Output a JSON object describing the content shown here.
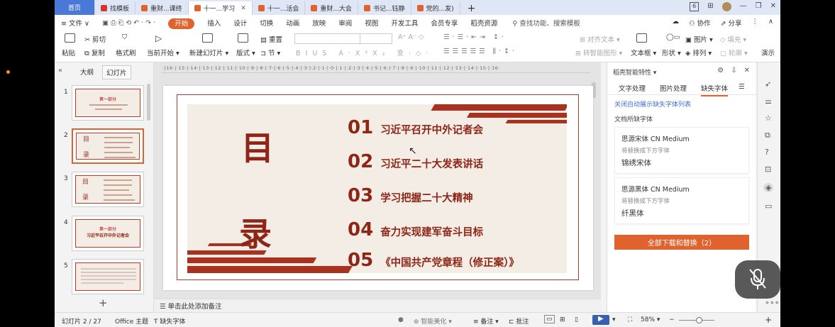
{
  "tabs": [
    {
      "label": "首页",
      "kind": "home"
    },
    {
      "label": "找模板",
      "kind": "red"
    },
    {
      "label": "重财...课终",
      "kind": "doc"
    },
    {
      "label": "十一...学习",
      "kind": "doc",
      "active": true
    },
    {
      "label": "十一...活会",
      "kind": "doc"
    },
    {
      "label": "重财...大会",
      "kind": "doc"
    },
    {
      "label": "书记...钰静",
      "kind": "doc"
    },
    {
      "label": "党的...发)",
      "kind": "doc"
    }
  ],
  "window": {
    "badge": "6",
    "add_tab": "+"
  },
  "menu": {
    "file": "≡ 文件 ∨",
    "start": "开始",
    "items": [
      "插入",
      "设计",
      "切换",
      "动画",
      "放映",
      "审阅",
      "视图",
      "开发工具",
      "会员专享",
      "稻壳资源"
    ],
    "search": "查找功能、搜索模板",
    "collab": "协作",
    "share": "分享"
  },
  "toolbar": {
    "paste": "粘贴",
    "cut": "剪切",
    "copy": "复制",
    "format_painter": "格式刷",
    "from_current": "当前开始",
    "new_slide": "新建幻灯片",
    "layout": "版式",
    "section": "节",
    "reset": "重置",
    "textbox": "文本框",
    "shape": "形状",
    "arrange": "排列",
    "picture": "图片",
    "fill": "填充",
    "outline": "轮廓",
    "align_text": "对齐文本",
    "smartart": "转智能图形",
    "present": "演示"
  },
  "leftpanel": {
    "outline_tab": "大纲",
    "slides_tab": "幻灯片",
    "thumbs": [
      {
        "num": "1",
        "type": "title",
        "text": "第一部分"
      },
      {
        "num": "2",
        "type": "toc",
        "selected": true
      },
      {
        "num": "3",
        "type": "toc"
      },
      {
        "num": "4",
        "type": "section",
        "text": "习近平召开中外记者会"
      },
      {
        "num": "5",
        "type": "text"
      }
    ]
  },
  "ruler": "·|16·|·15·|·14·|·13·|·12·|·11·|·10·|·9·|·8·|·7·|·6·|·5·|·4·|·3·|·2·|·1·|·0·|·1·|·2·|·3·|·4·|·5·|·6·|·7·|·8·|·9·|·10·|·11·|·12·|·13·|·14·|·15·|·16·",
  "slide": {
    "char1": "目",
    "char2": "录",
    "items": [
      {
        "num": "01",
        "text": "习近平召开中外记者会"
      },
      {
        "num": "02",
        "text": "习近平二十大发表讲话"
      },
      {
        "num": "03",
        "text": "学习把握二十大精神"
      },
      {
        "num": "04",
        "text": "奋力实现建军奋斗目标"
      },
      {
        "num": "05",
        "text": "《中国共产党章程（修正案）》"
      }
    ],
    "accent": "#8d2617"
  },
  "notes_placeholder": "单击此处添加备注",
  "rightpanel": {
    "title": "稻壳智能特性",
    "tabs": [
      "文字处理",
      "图片处理",
      "缺失字体"
    ],
    "active_tab": "缺失字体",
    "link": "关闭自动展示缺失字体列表",
    "subheading": "文档所缺字体",
    "fonts": [
      {
        "name": "思源宋体 CN Medium",
        "hint": "将替换成下方字体",
        "replacement": "锦绣宋体"
      },
      {
        "name": "思源黑体 CN Medium",
        "hint": "将替换成下方字体",
        "replacement": "纤黑体"
      }
    ],
    "download_btn": "全部下载和替换（2）",
    "accent": "#e0632e"
  },
  "status": {
    "slide_count": "幻灯片 2 / 27",
    "theme": "Office 主题",
    "missing_font": "缺失字体",
    "beautify": "智能美化",
    "notes": "备注",
    "comments": "批注",
    "zoom": "58%",
    "minus": "−",
    "plus": "+"
  }
}
